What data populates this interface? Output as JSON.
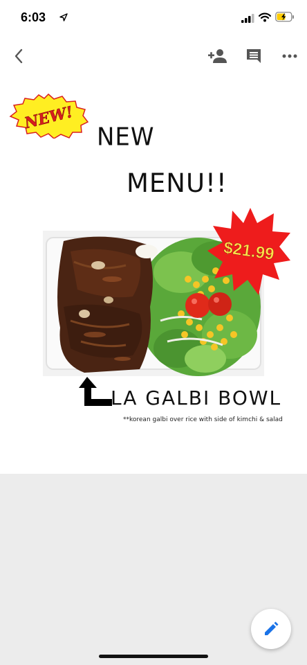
{
  "status": {
    "time": "6:03"
  },
  "flyer": {
    "badge": "NEW!",
    "title_line1": "NEW",
    "title_line2": "MENU!!",
    "price": "$21.99",
    "dish_name": "LA GALBI BOWL",
    "dish_description": "**korean galbi over rice with side of kimchi & salad"
  },
  "icons": {
    "location": "location-arrow-icon",
    "signal": "cellular-signal-icon",
    "wifi": "wifi-icon",
    "battery": "battery-charging-icon",
    "back": "chevron-left-icon",
    "add_person": "add-person-icon",
    "comment": "comment-icon",
    "more": "more-horizontal-icon",
    "edit": "pencil-icon"
  },
  "colors": {
    "accent_blue": "#1a73e8",
    "badge_yellow": "#ffee22",
    "badge_red": "#d91e1e",
    "price_red": "#ee1c1c",
    "gray_area": "#ececec"
  }
}
